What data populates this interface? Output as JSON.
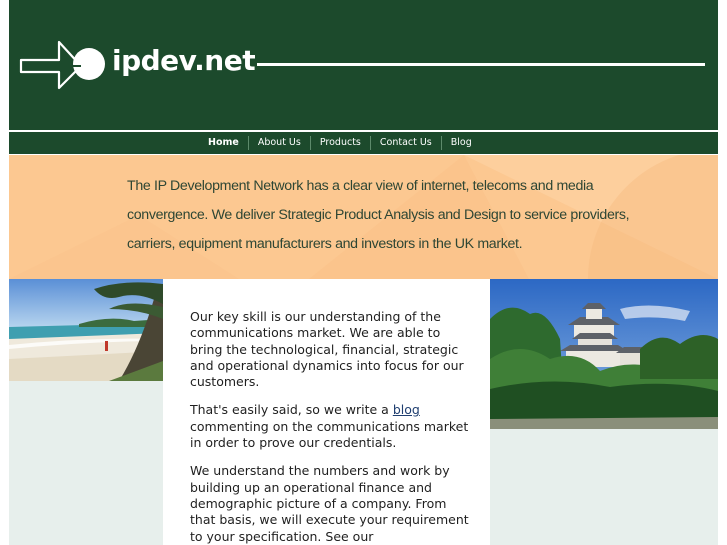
{
  "header": {
    "brand": "ipdev.net"
  },
  "nav": {
    "items": [
      {
        "label": "Home",
        "active": true
      },
      {
        "label": "About Us",
        "active": false
      },
      {
        "label": "Products",
        "active": false
      },
      {
        "label": "Contact Us",
        "active": false
      },
      {
        "label": "Blog",
        "active": false
      }
    ]
  },
  "banner": {
    "text": "The IP Development Network has a clear view of internet, telecoms and media convergence. We deliver Strategic Product Analysis and Design to service providers, carriers, equipment manufacturers and investors in the UK market."
  },
  "content": {
    "p1": "Our key skill is our understanding of the communications market. We are able to bring the technological, financial, strategic and operational dynamics into focus for our customers.",
    "p2_before": "That's easily said, so we write a ",
    "p2_link": "blog",
    "p2_after": " commenting on the communications market in order to prove our credentials.",
    "p3": "We understand the numbers and work by building up an operational finance and demographic picture of a company. From that basis, we will execute your requirement to your specification. See our"
  },
  "colors": {
    "header_green": "#1c4a2c",
    "banner_peach": "#fcc891",
    "side_column": "#e7efec",
    "link": "#1f3e70"
  }
}
